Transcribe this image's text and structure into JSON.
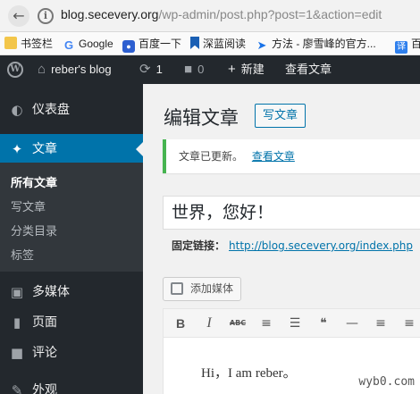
{
  "browser": {
    "url_host": "blog.secevery.org",
    "url_path": "/wp-admin/post.php?post=1&action=edit",
    "bookmarks": [
      "书签栏",
      "Google",
      "百度一下",
      "深蓝阅读",
      "方法 - 廖雪峰的官方...",
      "百"
    ]
  },
  "adminbar": {
    "site_name": "reber's blog",
    "updates_count": "1",
    "comments_count": "0",
    "new_label": "新建",
    "view_post_label": "查看文章"
  },
  "sidebar": {
    "items": [
      {
        "label": "仪表盘",
        "icon": "dashboard-icon"
      },
      {
        "label": "文章",
        "icon": "pin-icon"
      },
      {
        "label": "多媒体",
        "icon": "media-icon"
      },
      {
        "label": "页面",
        "icon": "page-icon"
      },
      {
        "label": "评论",
        "icon": "comment-icon"
      },
      {
        "label": "外观",
        "icon": "brush-icon"
      }
    ],
    "submenu": [
      "所有文章",
      "写文章",
      "分类目录",
      "标签"
    ]
  },
  "main": {
    "page_title": "编辑文章",
    "add_new_label": "写文章",
    "notice_text": "文章已更新。",
    "notice_link": "查看文章",
    "post_title": "世界，您好！",
    "permalink_label": "固定链接：",
    "permalink_url": "http://blog.secevery.org/index.php",
    "add_media_label": "添加媒体",
    "editor_content": "Hi，I am reber。"
  },
  "colors": {
    "admin_dark": "#23282d",
    "accent_blue": "#0073aa",
    "notice_green": "#46b450"
  },
  "watermark": "wyb0.com"
}
